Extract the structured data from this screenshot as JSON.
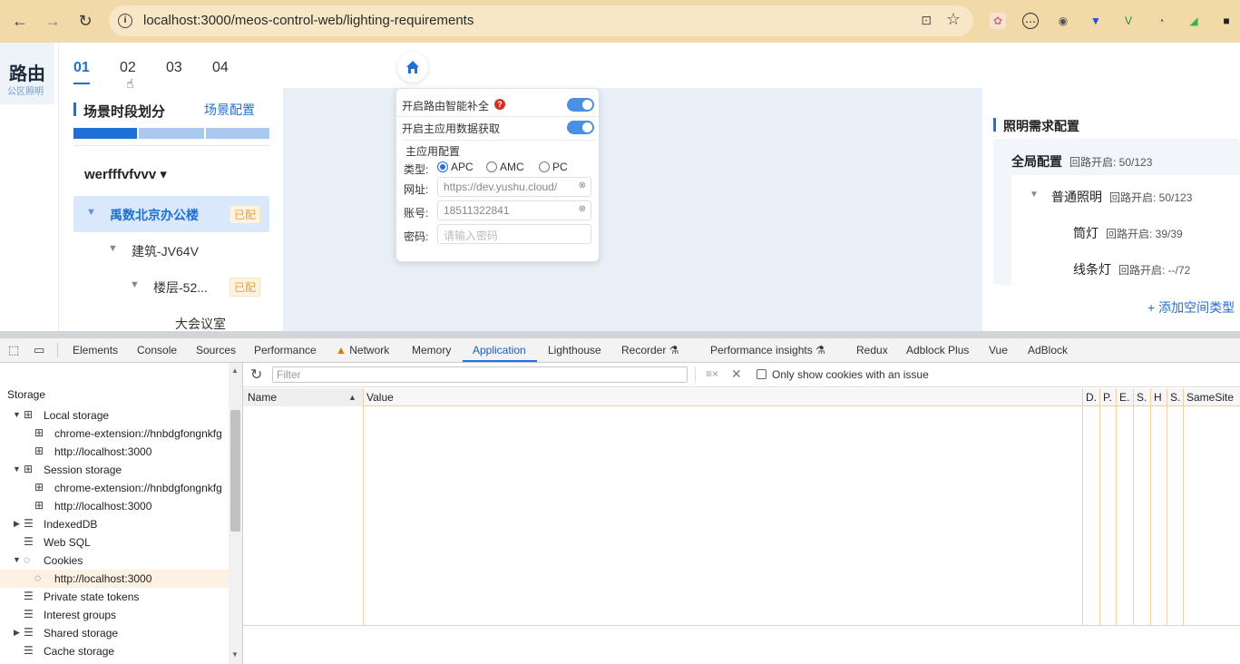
{
  "browser": {
    "url": "localhost:3000/meos-control-web/lighting-requirements",
    "icons": [
      "back-icon",
      "forward-icon",
      "reload-icon",
      "info-icon",
      "translate-icon",
      "star-icon"
    ]
  },
  "app": {
    "logo_title": "路由",
    "logo_subtitle": "公区照明",
    "tabs": [
      "01",
      "02",
      "03",
      "04"
    ],
    "active_tab": "01",
    "scene_section_title": "场景时段划分",
    "scene_config_link": "场景配置",
    "tree_root": "werfffvfvvv",
    "tree": {
      "building_group": "禹数北京办公楼",
      "building": "建筑-JV64V",
      "floor": "楼层-52...",
      "room": "大会议室",
      "badge": "已配"
    },
    "popup": {
      "toggle1_label": "开启路由智能补全",
      "toggle2_label": "开启主应用数据获取",
      "main_app_title": "主应用配置",
      "type_label": "类型:",
      "type_options": [
        "APC",
        "AMC",
        "PC"
      ],
      "selected_type": "APC",
      "url_label": "网址:",
      "url_value": "https://dev.yushu.cloud/",
      "account_label": "账号:",
      "account_value": "18511322841",
      "password_label": "密码:",
      "password_placeholder": "请输入密码"
    },
    "lighting": {
      "title": "照明需求配置",
      "global_label": "全局配置",
      "global_status": "回路开启: 50/123",
      "general_label": "普通照明",
      "general_status": "回路开启: 50/123",
      "downlight_label": "筒灯",
      "downlight_status": "回路开启: 39/39",
      "strip_label": "线条灯",
      "strip_status": "回路开启: --/72",
      "add_link": "+ 添加空间类型"
    }
  },
  "devtools": {
    "tabs": [
      "Elements",
      "Console",
      "Sources",
      "Performance",
      "Network",
      "Memory",
      "Application",
      "Lighthouse",
      "Recorder",
      "Performance insights",
      "Redux",
      "Adblock Plus",
      "Vue",
      "AdBlock"
    ],
    "active_tab": "Application",
    "sidebar": {
      "storage_heading": "Storage",
      "local_storage": "Local storage",
      "local_ext": "chrome-extension://hnbdgfongnkfg",
      "local_host": "http://localhost:3000",
      "session_storage": "Session storage",
      "session_ext": "chrome-extension://hnbdgfongnkfg",
      "session_host": "http://localhost:3000",
      "indexeddb": "IndexedDB",
      "websql": "Web SQL",
      "cookies": "Cookies",
      "cookies_host": "http://localhost:3000",
      "private_state_tokens": "Private state tokens",
      "interest_groups": "Interest groups",
      "shared_storage": "Shared storage",
      "cache_storage": "Cache storage"
    },
    "toolbar": {
      "filter_placeholder": "Filter",
      "only_issue_label": "Only show cookies with an issue"
    },
    "columns": [
      "Name",
      "Value",
      "D.",
      "P.",
      "E.",
      "S.",
      "H",
      "S.",
      "SameSite"
    ]
  },
  "colors": {
    "browser_bar": "#f1d9a8",
    "accent": "#1f6fd6",
    "badge": "#e6a23c",
    "devtools_active": "#1a73e8"
  }
}
